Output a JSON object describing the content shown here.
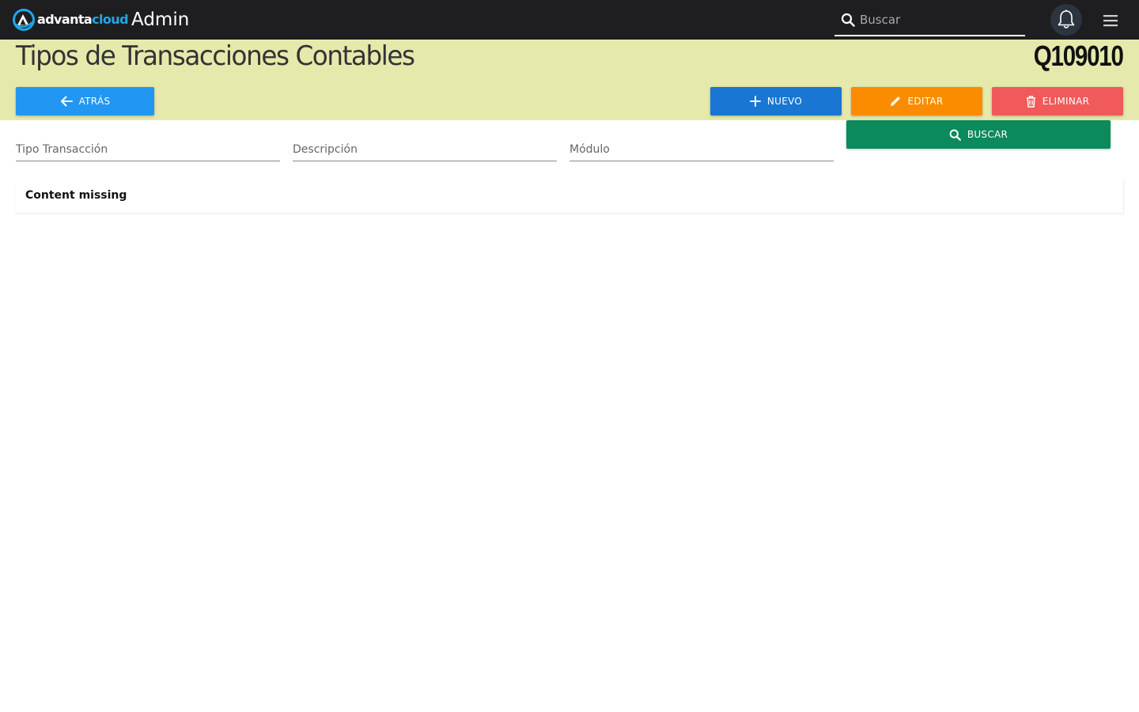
{
  "topbar": {
    "brand": {
      "part1": "advanta",
      "part2": "cloud"
    },
    "app_title": "Admin",
    "search_placeholder": "Buscar",
    "icons": {
      "search": "search-icon",
      "bell": "bell-icon",
      "menu": "hamburger-icon"
    }
  },
  "header": {
    "title": "Tipos de Transacciones Contables",
    "code": "Q109010"
  },
  "toolbar": {
    "back_label": "ATRÁS",
    "new_label": "NUEVO",
    "edit_label": "EDITAR",
    "delete_label": "ELIMINAR",
    "search_label": "BUSCAR"
  },
  "filters": {
    "tipo_placeholder": "Tipo Transacción",
    "descripcion_placeholder": "Descripción",
    "modulo_placeholder": "Módulo"
  },
  "content": {
    "message": "Content missing"
  },
  "colors": {
    "topbar": "#1e1e20",
    "header_band": "#e6e9ac",
    "back": "#2196f3",
    "new": "#1976d2",
    "edit": "#fb8c00",
    "delete": "#f05a5a",
    "search": "#0b8a5b",
    "brand_accent": "#1fa7e8"
  }
}
